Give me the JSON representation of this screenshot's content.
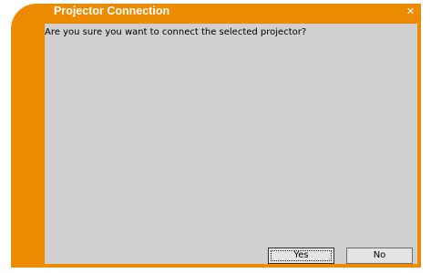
{
  "dialog": {
    "title": "Projector Connection",
    "close_icon": "close-icon",
    "message": "Are you sure you want to connect the selected projector?",
    "buttons": {
      "yes_label": "Yes",
      "no_label": "No"
    },
    "colors": {
      "frame": "#ec8a00",
      "content_background": "#d0d0d0",
      "title_text": "#ffffff"
    }
  }
}
